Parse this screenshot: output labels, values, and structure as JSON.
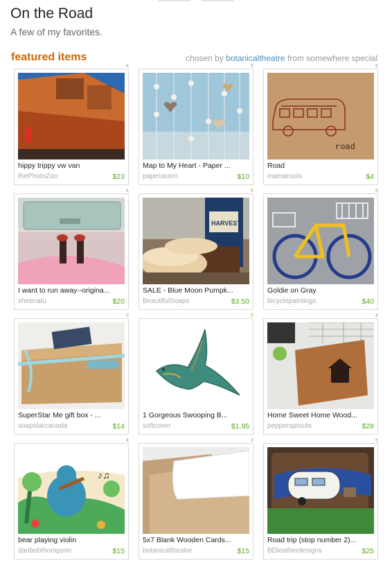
{
  "header": {
    "title": "On the Road",
    "subtitle": "A few of my favorites."
  },
  "section": {
    "heading": "featured items",
    "chosen_by_label": "chosen by",
    "curator": "botanicaltheatre",
    "from_label": "from",
    "location": "somewhere special"
  },
  "colors": {
    "accent": "#d56500",
    "price": "#5eaa1e",
    "link": "#4a8fc0"
  },
  "items": [
    {
      "title": "hippy trippy vw van",
      "shop": "thePhotoZoo",
      "price": "$23",
      "rank": "4"
    },
    {
      "title": "Map to My Heart - Paper ...",
      "shop": "paperacorn",
      "price": "$10",
      "rank": "5"
    },
    {
      "title": "Road",
      "shop": "mamaroots",
      "price": "$4",
      "rank": "6"
    },
    {
      "title": "I want to run away--origina...",
      "shop": "sheenalu",
      "price": "$20",
      "rank": "4"
    },
    {
      "title": "SALE - Blue Moon Pumpk...",
      "shop": "BeautifulSoaps",
      "price": "$3.50",
      "rank": "5"
    },
    {
      "title": "Goldie on Gray",
      "shop": "bicyclepaintings",
      "price": "$40",
      "rank": "6"
    },
    {
      "title": "SuperStar Me gift box - ...",
      "shop": "soapstarcanada",
      "price": "$14",
      "rank": "5"
    },
    {
      "title": "1 Gorgeous Swooping B...",
      "shop": "softcover",
      "price": "$1.95",
      "rank": "5"
    },
    {
      "title": "Home Sweet Home Wood...",
      "shop": "peppersprouts",
      "price": "$28",
      "rank": "4"
    },
    {
      "title": "bear playing violin",
      "shop": "danbobthompson",
      "price": "$15",
      "rank": "4"
    },
    {
      "title": "5x7 Blank Wooden Cards...",
      "shop": "botanicaltheatre",
      "price": "$15",
      "rank": "3"
    },
    {
      "title": "Road trip (stop number 2)...",
      "shop": "BDleatherdesigns",
      "price": "$25",
      "rank": "5"
    }
  ],
  "thumbnails": [
    "vw-van-photo",
    "paper-hearts-garland-photo",
    "van-stamped-card-photo",
    "suitcase-feet-photo",
    "soap-and-beer-photo",
    "yellow-bicycle-painting",
    "gift-box-photo",
    "bird-pendant-photo",
    "wooden-house-card-photo",
    "bear-violin-illustration",
    "blank-wooden-cards-photo",
    "camper-leather-notebook-photo"
  ]
}
